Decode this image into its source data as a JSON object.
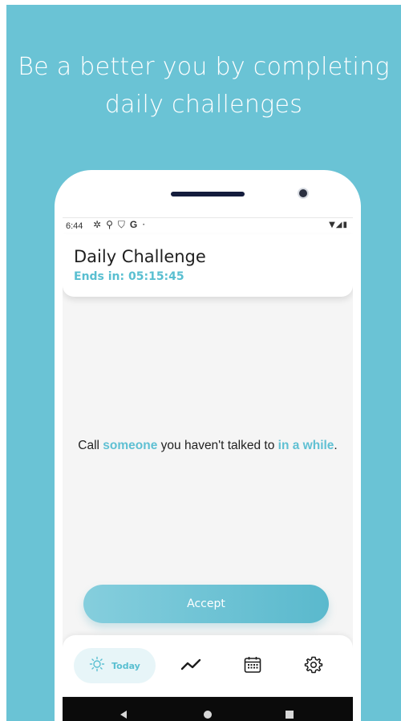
{
  "promo": {
    "headline_line1": "Be a better you by completing",
    "headline_line2": "daily challenges",
    "background_color": "#6ac3d5"
  },
  "status_bar": {
    "time": "6:44",
    "left_icons": [
      "settings-icon",
      "location-icon",
      "shield-icon",
      "google-icon",
      "dot-icon"
    ],
    "right_icons": [
      "wifi-icon",
      "signal-icon",
      "battery-icon"
    ]
  },
  "header": {
    "title": "Daily Challenge",
    "countdown_label": "Ends in: 05:15:45"
  },
  "challenge": {
    "part1": "Call ",
    "highlight1": "someone",
    "part2": " you haven't talked to ",
    "highlight2": "in a while",
    "part3": "."
  },
  "accept_button": {
    "label": "Accept"
  },
  "bottom_nav": {
    "items": [
      {
        "label": "Today",
        "icon": "sun-icon",
        "active": true
      },
      {
        "label": "",
        "icon": "trend-icon",
        "active": false
      },
      {
        "label": "",
        "icon": "calendar-icon",
        "active": false
      },
      {
        "label": "",
        "icon": "gear-icon",
        "active": false
      }
    ]
  },
  "system_nav": [
    "back-icon",
    "home-icon",
    "recents-icon"
  ],
  "colors": {
    "accent": "#5fc0d3",
    "screen_background": "#f5f5f5"
  }
}
